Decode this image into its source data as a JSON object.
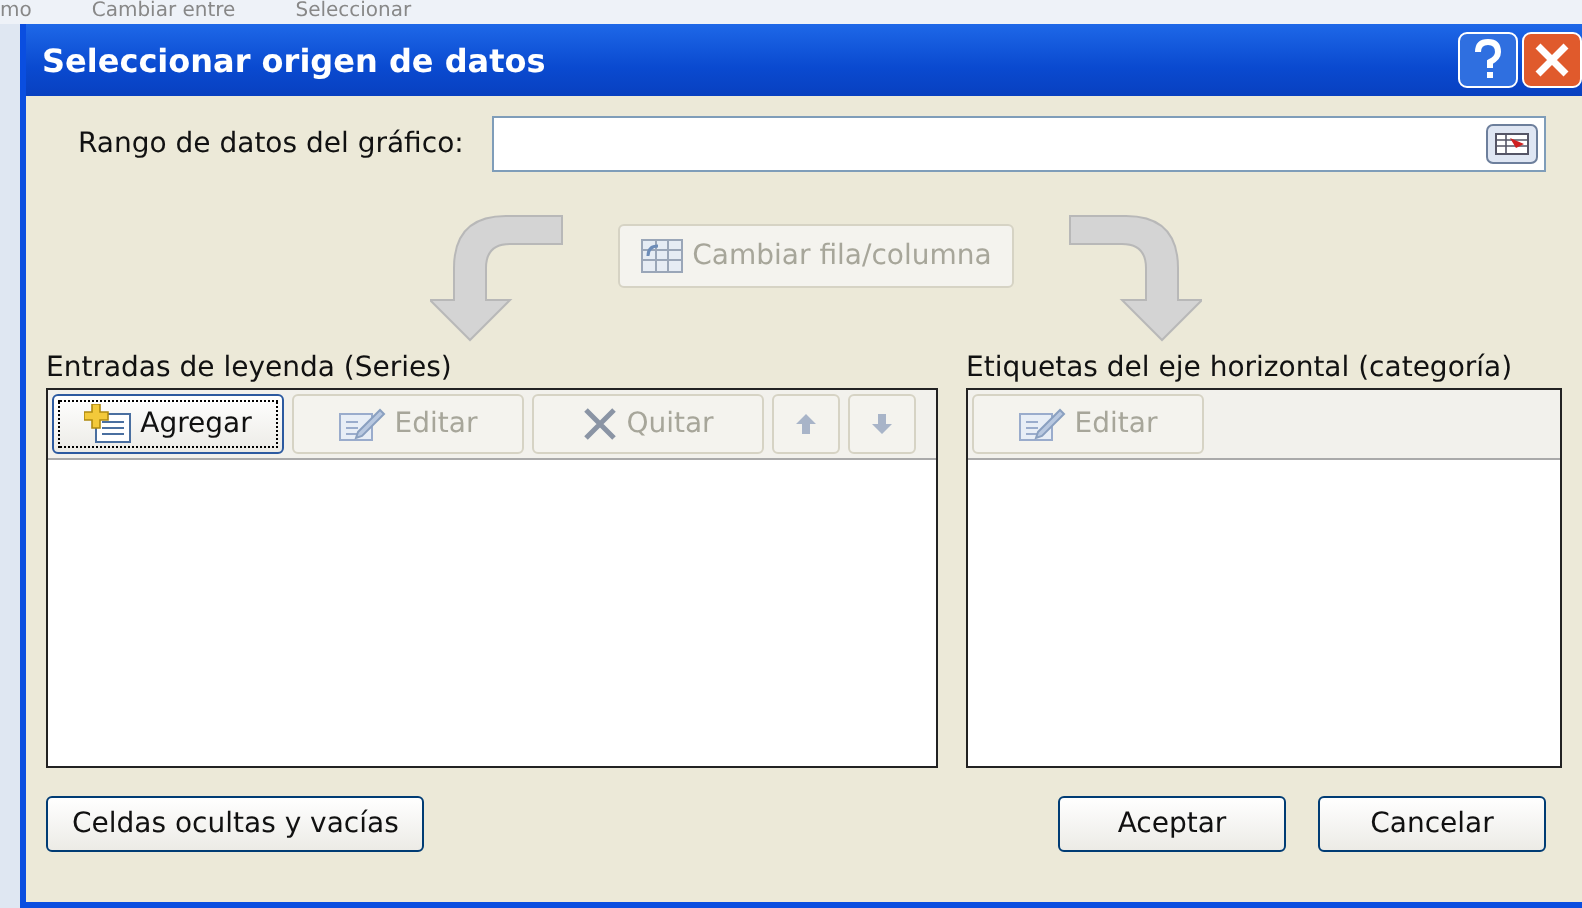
{
  "background": {
    "texts": [
      "mo",
      "Cambiar entre",
      "Seleccionar"
    ]
  },
  "window": {
    "title": "Seleccionar origen de datos"
  },
  "range_field": {
    "label": "Rango de datos del gráfico:"
  },
  "switch_button": {
    "label": "Cambiar fila/columna",
    "disabled": true
  },
  "series_panel": {
    "title": "Entradas de leyenda (Series)",
    "toolbar": [
      {
        "kind": "add",
        "label": "Agregar",
        "disabled": false
      },
      {
        "kind": "edit",
        "label": "Editar",
        "disabled": true
      },
      {
        "kind": "remove",
        "label": "Quitar",
        "disabled": true
      },
      {
        "kind": "up",
        "disabled": true
      },
      {
        "kind": "down",
        "disabled": true
      }
    ]
  },
  "category_panel": {
    "title": "Etiquetas del eje horizontal (categoría)",
    "toolbar": [
      {
        "kind": "edit",
        "label": "Editar",
        "disabled": true
      }
    ]
  },
  "hidden_cells_button": {
    "label": "Celdas ocultas y vacías"
  },
  "buttons": [
    "Aceptar",
    "Cancelar"
  ]
}
